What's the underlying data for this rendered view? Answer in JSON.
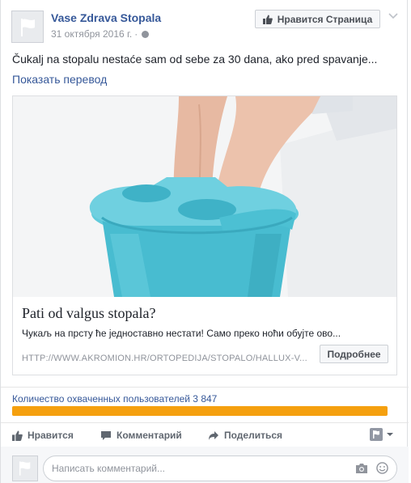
{
  "post": {
    "page_name": "Vase Zdrava Stopala",
    "date": "31 октября 2016 г.",
    "separator": "·",
    "like_page_label": "Нравится Страница",
    "text": "Čukalj na stopalu nestaće sam od sebe za 30 dana, ako pred spavanje...",
    "translate_label": "Показать перевод"
  },
  "link": {
    "title": "Pati od valgus stopala?",
    "description": "Чукаљ на прсту ће једноставно нестати! Само преко ноћи обујте ово...",
    "url": "HTTP://WWW.AKROMION.HR/ORTOPEDIJA/STOPALO/HALLUX-V...",
    "more_label": "Подробнее"
  },
  "reach": {
    "label": "Количество охваченных пользователей 3 847",
    "progress_fraction": 1.0,
    "bar_color": "#f5a00f"
  },
  "actions": {
    "like": "Нравится",
    "comment": "Комментарий",
    "share": "Поделиться"
  },
  "composer": {
    "placeholder": "Написать комментарий..."
  },
  "icons": [
    "flag-avatar-icon",
    "globe-icon",
    "thumbs-up-icon",
    "chevron-down-icon",
    "comment-icon",
    "share-icon",
    "flag-menu-icon",
    "camera-icon",
    "smiley-icon"
  ],
  "colors": {
    "link": "#365899",
    "meta": "#90949c",
    "accent_basin": "#4ec3d6"
  }
}
